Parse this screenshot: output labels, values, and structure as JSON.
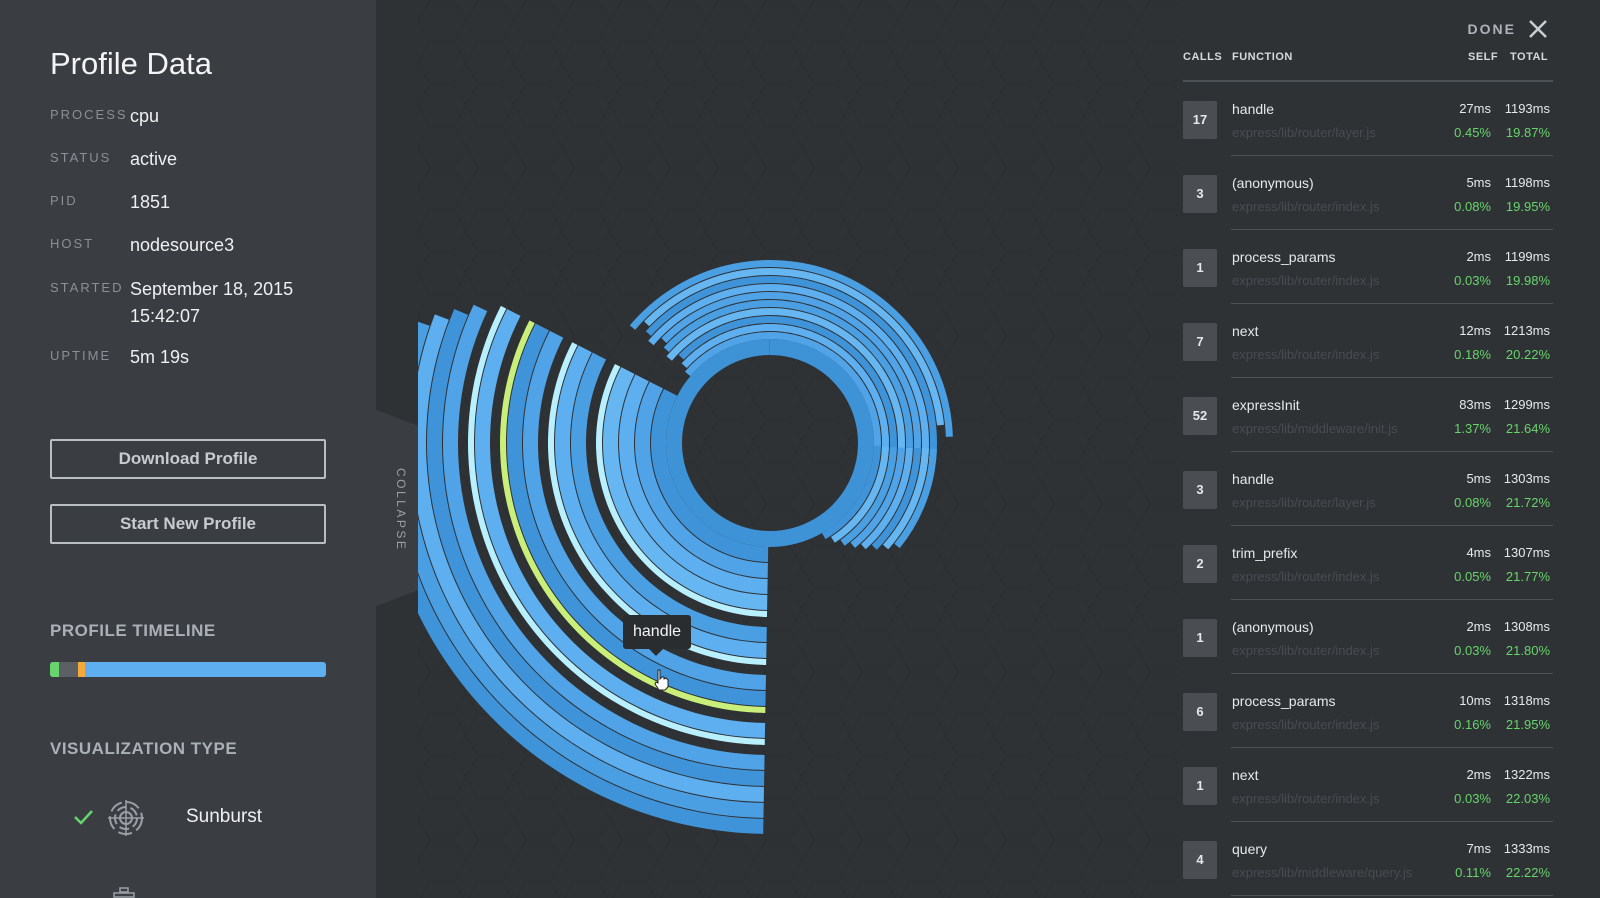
{
  "profile": {
    "title": "Profile Data",
    "meta": [
      {
        "label": "PROCESS",
        "value": "cpu"
      },
      {
        "label": "STATUS",
        "value": "active"
      },
      {
        "label": "PID",
        "value": "1851"
      },
      {
        "label": "HOST",
        "value": "nodesource3"
      },
      {
        "label": "STARTED",
        "value": "September 18, 2015\n15:42:07"
      },
      {
        "label": "UPTIME",
        "value": "5m 19s"
      }
    ],
    "download_label": "Download Profile",
    "start_label": "Start New Profile",
    "timeline_title": "PROFILE TIMELINE",
    "timeline_colors": {
      "start": "#67d46c",
      "gap": "#5b6065",
      "marker": "#f4a93a",
      "main": "#5daff0"
    },
    "viz_title": "VISUALIZATION TYPE",
    "viz_selected": "Sunburst",
    "viz_icons": [
      "check-icon",
      "sunburst-icon",
      "flame-icon"
    ]
  },
  "collapse_label": "COLLAPSE",
  "tooltip": "handle",
  "table": {
    "done_label": "DONE",
    "headers": {
      "calls": "CALLS",
      "function": "FUNCTION",
      "self": "SELF",
      "total": "TOTAL"
    },
    "rows": [
      {
        "calls": "17",
        "fn": "handle",
        "path": "express/lib/router/layer.js",
        "self": "27ms",
        "total": "1193ms",
        "selfp": "0.45%",
        "totalp": "19.87%"
      },
      {
        "calls": "3",
        "fn": "(anonymous)",
        "path": "express/lib/router/index.js",
        "self": "5ms",
        "total": "1198ms",
        "selfp": "0.08%",
        "totalp": "19.95%"
      },
      {
        "calls": "1",
        "fn": "process_params",
        "path": "express/lib/router/index.js",
        "self": "2ms",
        "total": "1199ms",
        "selfp": "0.03%",
        "totalp": "19.98%"
      },
      {
        "calls": "7",
        "fn": "next",
        "path": "express/lib/router/index.js",
        "self": "12ms",
        "total": "1213ms",
        "selfp": "0.18%",
        "totalp": "20.22%"
      },
      {
        "calls": "52",
        "fn": "expressInit",
        "path": "express/lib/middleware/init.js",
        "self": "83ms",
        "total": "1299ms",
        "selfp": "1.37%",
        "totalp": "21.64%"
      },
      {
        "calls": "3",
        "fn": "handle",
        "path": "express/lib/router/layer.js",
        "self": "5ms",
        "total": "1303ms",
        "selfp": "0.08%",
        "totalp": "21.72%"
      },
      {
        "calls": "2",
        "fn": "trim_prefix",
        "path": "express/lib/router/index.js",
        "self": "4ms",
        "total": "1307ms",
        "selfp": "0.05%",
        "totalp": "21.77%"
      },
      {
        "calls": "1",
        "fn": "(anonymous)",
        "path": "express/lib/router/index.js",
        "self": "2ms",
        "total": "1308ms",
        "selfp": "0.03%",
        "totalp": "21.80%"
      },
      {
        "calls": "6",
        "fn": "process_params",
        "path": "express/lib/router/index.js",
        "self": "10ms",
        "total": "1318ms",
        "selfp": "0.16%",
        "totalp": "21.95%"
      },
      {
        "calls": "1",
        "fn": "next",
        "path": "express/lib/router/index.js",
        "self": "2ms",
        "total": "1322ms",
        "selfp": "0.03%",
        "totalp": "22.03%"
      },
      {
        "calls": "4",
        "fn": "query",
        "path": "express/lib/middleware/query.js",
        "self": "7ms",
        "total": "1333ms",
        "selfp": "0.11%",
        "totalp": "22.22%"
      }
    ]
  },
  "colors": {
    "accent_blue": "#5daff0",
    "highlight_green": "#c9ef7a",
    "highlight_cyan": "#b8f0ff",
    "percent_green": "#67d46c"
  }
}
